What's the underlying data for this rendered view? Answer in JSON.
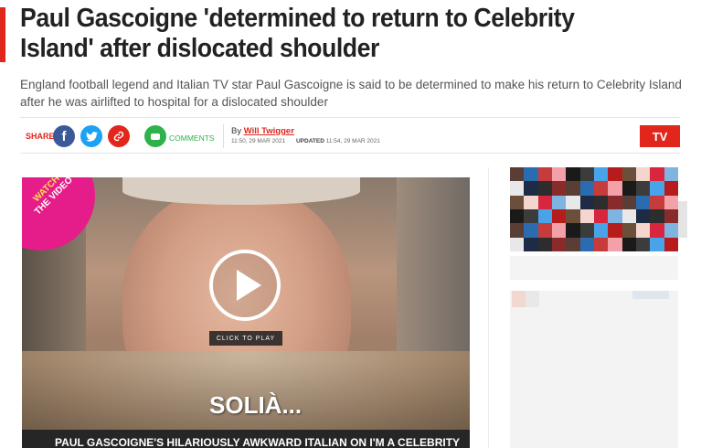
{
  "article": {
    "headline": "Paul Gascoigne 'determined to return to Celebrity Island' after dislocated shoulder",
    "standfirst": "England football legend and Italian TV star Paul Gascoigne is said to be determined to make his return to Celebrity Island after he was airlifted to hospital for a dislocated shoulder"
  },
  "share": {
    "label": "SHARE",
    "facebook_glyph": "f",
    "comments_label": "COMMENTS"
  },
  "byline": {
    "prefix": "By",
    "author": "Will Twigger",
    "published": "11:50, 29 MAR 2021",
    "updated_label": "UPDATED",
    "updated": "11:54, 29 MAR 2021"
  },
  "tv_button": {
    "label": "TV"
  },
  "video": {
    "badge_line1": "WATCH",
    "badge_line2": "THE VIDEO",
    "click_label": "CLICK TO PLAY",
    "subtitle_word": "SOLIÀ...",
    "title": "PAUL GASCOIGNE'S HILARIOUSLY AWKWARD ITALIAN ON I'M A CELEBRITY"
  },
  "icons": {
    "facebook": "facebook-icon",
    "twitter": "twitter-icon",
    "link": "link-icon",
    "comments": "comment-icon",
    "play": "play-icon"
  },
  "colors": {
    "accent": "#e1261c",
    "facebook": "#3b5998",
    "twitter": "#1da1f2",
    "comments": "#2fb24c",
    "watch_badge": "#e51d8a"
  }
}
